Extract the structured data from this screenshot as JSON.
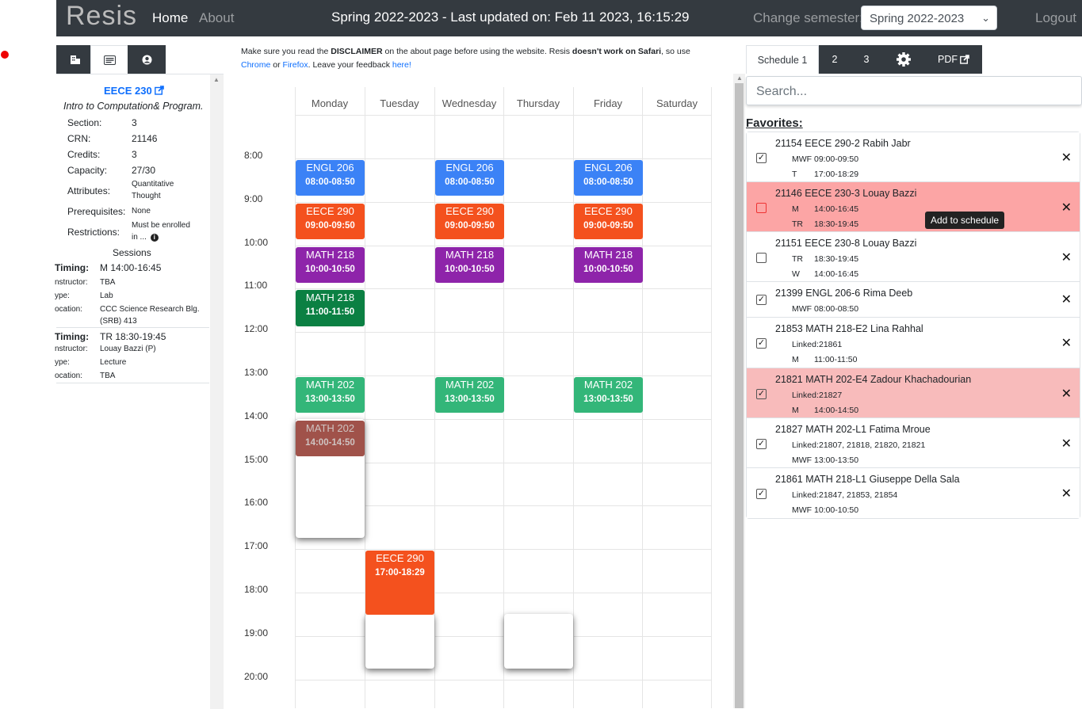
{
  "nav": {
    "logo": "Resis",
    "home": "Home",
    "about": "About",
    "status": "Spring 2022-2023 - Last updated on: Feb 11 2023, 16:15:29",
    "change_semester": "Change semester:",
    "semester_value": "Spring 2022-2023",
    "logout": "Logout"
  },
  "left": {
    "tabs": [
      {
        "icon": "building-icon",
        "active": false
      },
      {
        "icon": "card-icon",
        "active": true
      },
      {
        "icon": "user-icon",
        "active": false
      }
    ],
    "course_code": "EECE 230",
    "course_name": "Intro to Computation& Program.",
    "fields": {
      "section_k": "Section:",
      "section_v": "3",
      "crn_k": "CRN:",
      "crn_v": "21146",
      "credits_k": "Credits:",
      "credits_v": "3",
      "capacity_k": "Capacity:",
      "capacity_v": "27/30",
      "attributes_k": "Attributes:",
      "attributes_v1": "Quantitative",
      "attributes_v2": "Thought",
      "prereq_k": "Prerequisites:",
      "prereq_v": "None",
      "restrict_k": "Restrictions:",
      "restrict_v1": "Must be enrolled",
      "restrict_v2": "in ..."
    },
    "sessions_label": "Sessions",
    "sessions": [
      {
        "timing_k": "Timing:",
        "timing_v": "M 14:00-16:45",
        "instr_k": "nstructor:",
        "instr_v": "TBA",
        "type_k": "ype:",
        "type_v": "Lab",
        "loc_k": "ocation:",
        "loc_v1": "CCC Science Research Blg.",
        "loc_v2": "(SRB) 413"
      },
      {
        "timing_k": "Timing:",
        "timing_v": "TR 18:30-19:45",
        "instr_k": "nstructor:",
        "instr_v": "Louay Bazzi (P)",
        "type_k": "ype:",
        "type_v": "Lecture",
        "loc_k": "ocation:",
        "loc_v1": "TBA",
        "loc_v2": ""
      }
    ]
  },
  "disclaimer": {
    "p1": "Make sure you read the ",
    "b1": "DISCLAIMER",
    "p2": " on the about page before using the website. Resis ",
    "b2": "doesn't work on Safari",
    "p3": ", so use ",
    "chrome": "Chrome",
    "p4": " or ",
    "firefox": "Firefox",
    "p5": ". Leave your feedback ",
    "here": "here!"
  },
  "calendar": {
    "days": [
      "Monday",
      "Tuesday",
      "Wednesday",
      "Thursday",
      "Friday",
      "Saturday"
    ],
    "times": [
      "8:00",
      "9:00",
      "10:00",
      "11:00",
      "12:00",
      "13:00",
      "14:00",
      "15:00",
      "16:00",
      "17:00",
      "18:00",
      "19:00",
      "20:00"
    ],
    "events": [
      {
        "title": "ENGL 206",
        "time": "08:00-08:50",
        "day": 0,
        "start": 8.0,
        "end": 8.83,
        "color": "#3b82f6"
      },
      {
        "title": "ENGL 206",
        "time": "08:00-08:50",
        "day": 2,
        "start": 8.0,
        "end": 8.83,
        "color": "#3b82f6"
      },
      {
        "title": "ENGL 206",
        "time": "08:00-08:50",
        "day": 4,
        "start": 8.0,
        "end": 8.83,
        "color": "#3b82f6"
      },
      {
        "title": "EECE 290",
        "time": "09:00-09:50",
        "day": 0,
        "start": 9.0,
        "end": 9.83,
        "color": "#f4511e"
      },
      {
        "title": "EECE 290",
        "time": "09:00-09:50",
        "day": 2,
        "start": 9.0,
        "end": 9.83,
        "color": "#f4511e"
      },
      {
        "title": "EECE 290",
        "time": "09:00-09:50",
        "day": 4,
        "start": 9.0,
        "end": 9.83,
        "color": "#f4511e"
      },
      {
        "title": "MATH 218",
        "time": "10:00-10:50",
        "day": 0,
        "start": 10.0,
        "end": 10.83,
        "color": "#8e24aa"
      },
      {
        "title": "MATH 218",
        "time": "10:00-10:50",
        "day": 2,
        "start": 10.0,
        "end": 10.83,
        "color": "#8e24aa"
      },
      {
        "title": "MATH 218",
        "time": "10:00-10:50",
        "day": 4,
        "start": 10.0,
        "end": 10.83,
        "color": "#8e24aa"
      },
      {
        "title": "MATH 218",
        "time": "11:00-11:50",
        "day": 0,
        "start": 11.0,
        "end": 11.83,
        "color": "#0b8043"
      },
      {
        "title": "MATH 202",
        "time": "13:00-13:50",
        "day": 0,
        "start": 13.0,
        "end": 13.83,
        "color": "#33b679"
      },
      {
        "title": "MATH 202",
        "time": "13:00-13:50",
        "day": 2,
        "start": 13.0,
        "end": 13.83,
        "color": "#33b679"
      },
      {
        "title": "MATH 202",
        "time": "13:00-13:50",
        "day": 4,
        "start": 13.0,
        "end": 13.83,
        "color": "#33b679"
      },
      {
        "title": "MATH 202",
        "time": "14:00-14:50",
        "day": 0,
        "start": 14.0,
        "end": 14.83,
        "color": "#a0524a",
        "textColor": "#cfc4c2"
      },
      {
        "title": "EECE 290",
        "time": "17:00-18:29",
        "day": 1,
        "start": 17.0,
        "end": 18.48,
        "color": "#f4511e"
      }
    ],
    "ghosts": [
      {
        "day": 0,
        "start": 14.0,
        "end": 16.75
      },
      {
        "day": 1,
        "start": 18.5,
        "end": 19.75
      },
      {
        "day": 3,
        "start": 18.5,
        "end": 19.75
      }
    ]
  },
  "right": {
    "tabs": [
      "Schedule 1",
      "2",
      "3",
      "",
      "PDF"
    ],
    "search_placeholder": "Search...",
    "favorites_label": "Favorites:",
    "tooltip": "Add to schedule",
    "items": [
      {
        "title": "21154 EECE 290-2 Rabih Jabr",
        "checked": true,
        "bg": "#ffffff",
        "subs": [
          [
            "MWF",
            "09:00-09:50"
          ],
          [
            "T",
            "17:00-18:29"
          ]
        ]
      },
      {
        "title": "21146 EECE 230-3 Louay Bazzi",
        "checked": false,
        "red_box": true,
        "bg": "#fca5a5",
        "subs": [
          [
            "M",
            "14:00-16:45"
          ],
          [
            "TR",
            "18:30-19:45"
          ]
        ]
      },
      {
        "title": "21151 EECE 230-8 Louay Bazzi",
        "checked": false,
        "bg": "#ffffff",
        "subs": [
          [
            "TR",
            "18:30-19:45"
          ],
          [
            "W",
            "14:00-16:45"
          ]
        ]
      },
      {
        "title": "21399 ENGL 206-6 Rima Deeb",
        "checked": true,
        "bg": "#ffffff",
        "subs": [
          [
            "MWF",
            "08:00-08:50"
          ]
        ]
      },
      {
        "title": "21853 MATH 218-E2 Lina Rahhal",
        "checked": true,
        "bg": "#ffffff",
        "subs": [
          [
            "Linked:",
            "21861"
          ],
          [
            "M",
            "11:00-11:50"
          ]
        ]
      },
      {
        "title": "21821 MATH 202-E4 Zadour Khachadourian",
        "checked": true,
        "bg": "#f8bbbb",
        "subs": [
          [
            "Linked:",
            "21827"
          ],
          [
            "M",
            "14:00-14:50"
          ]
        ]
      },
      {
        "title": "21827 MATH 202-L1 Fatima Mroue",
        "checked": true,
        "bg": "#ffffff",
        "subs": [
          [
            "Linked:",
            "21807, 21818, 21820, 21821"
          ],
          [
            "MWF",
            "13:00-13:50"
          ]
        ]
      },
      {
        "title": "21861 MATH 218-L1 Giuseppe Della Sala",
        "checked": true,
        "bg": "#ffffff",
        "subs": [
          [
            "Linked:",
            "21847, 21853, 21854"
          ],
          [
            "MWF",
            "10:00-10:50"
          ]
        ]
      }
    ]
  }
}
